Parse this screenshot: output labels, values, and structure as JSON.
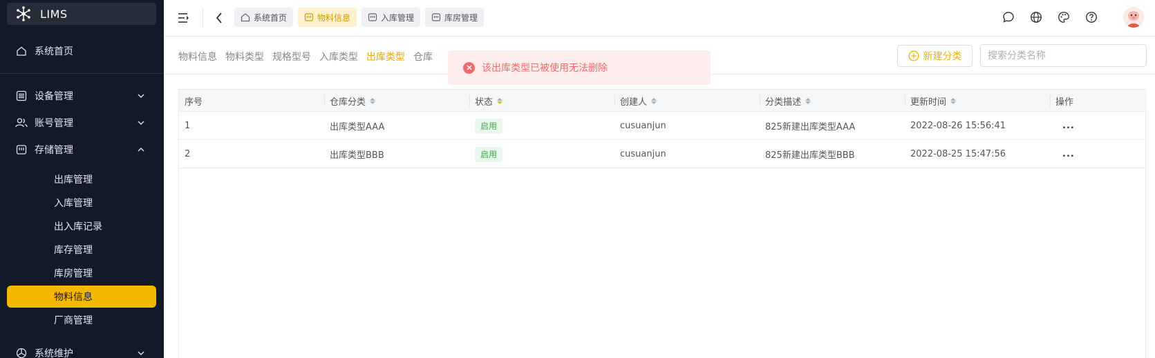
{
  "app": {
    "name": "LIMS"
  },
  "sidebar": {
    "top_items": [
      {
        "label": "系统首页",
        "icon": "home-icon"
      },
      {
        "label": "设备管理",
        "icon": "device-icon"
      },
      {
        "label": "账号管理",
        "icon": "users-icon"
      },
      {
        "label": "存储管理",
        "icon": "storage-icon"
      }
    ],
    "storage_sub": [
      "出库管理",
      "入库管理",
      "出入库记录",
      "库存管理",
      "库房管理",
      "物料信息",
      "厂商管理"
    ],
    "active_sub": "物料信息",
    "bottom_item": {
      "label": "系统维护",
      "icon": "maintenance-icon"
    }
  },
  "topbar": {
    "tags": [
      {
        "label": "系统首页",
        "icon": "home-icon"
      },
      {
        "label": "物料信息",
        "icon": "material-icon",
        "active": true
      },
      {
        "label": "入库管理",
        "icon": "inbound-icon"
      },
      {
        "label": "库房管理",
        "icon": "warehouse-icon"
      }
    ],
    "right_icons": [
      "message-icon",
      "globe-icon",
      "palette-icon",
      "help-icon"
    ]
  },
  "subtabs": [
    "物料信息",
    "物料类型",
    "规格型号",
    "入库类型",
    "出库类型",
    "仓库"
  ],
  "active_subtab": "出库类型",
  "actions": {
    "new_label": "新建分类",
    "search_placeholder": "搜索分类名称"
  },
  "toast": {
    "message": "该出库类型已被使用无法删除",
    "type": "error"
  },
  "table": {
    "columns": [
      "序号",
      "仓库分类",
      "状态",
      "创建人",
      "分类描述",
      "更新时间",
      "操作"
    ],
    "rows": [
      {
        "index": "1",
        "category": "出库类型AAA",
        "status": "启用",
        "creator": "cusuanjun",
        "desc": "825新建出库类型AAA",
        "updated": "2022-08-26 15:56:41",
        "op": "..."
      },
      {
        "index": "2",
        "category": "出库类型BBB",
        "status": "启用",
        "creator": "cusuanjun",
        "desc": "825新建出库类型BBB",
        "updated": "2022-08-25 15:47:56",
        "op": "..."
      }
    ]
  },
  "colors": {
    "accent": "#f5b800",
    "sidebar_bg": "#131a27",
    "error": "#f26a6a",
    "success": "#3da84b"
  }
}
